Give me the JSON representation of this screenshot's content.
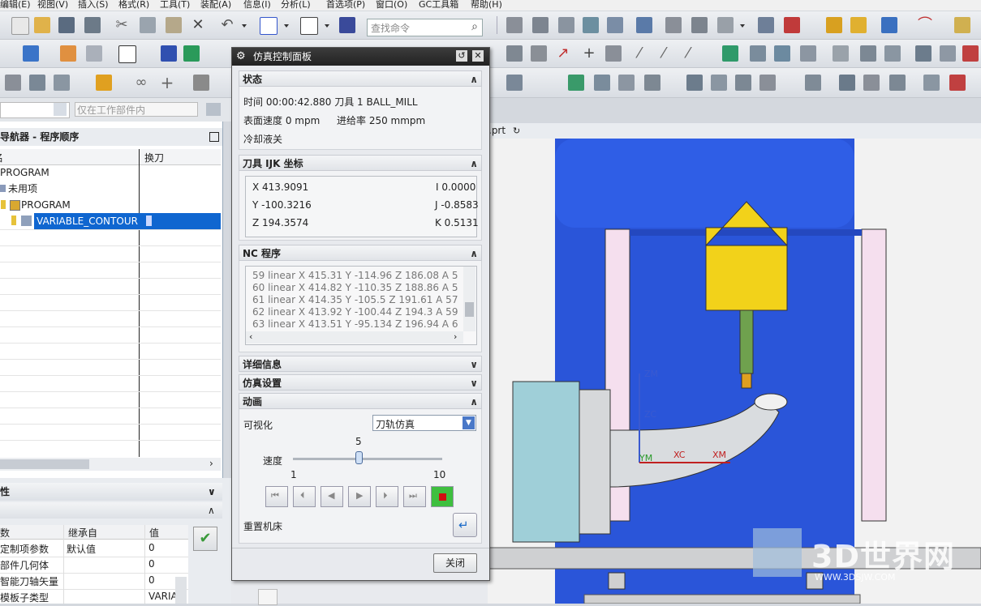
{
  "menubar": {
    "items": [
      "编辑(E)",
      "视图(V)",
      "插入(S)",
      "格式(R)",
      "工具(T)",
      "装配(A)",
      "信息(I)",
      "分析(L)",
      "首选项(P)",
      "窗口(O)",
      "GC工具箱",
      "帮助(H)"
    ]
  },
  "toolbar": {
    "search_placeholder": "查找命令"
  },
  "filter": {
    "scope": "仅在工作部件内"
  },
  "navigator": {
    "title": "导航器 - 程序顺序",
    "col_name": "名",
    "col_tool_change": "换刀",
    "rows": [
      {
        "label": "PROGRAM"
      },
      {
        "label": "未用项"
      },
      {
        "label": "PROGRAM"
      },
      {
        "label": "VARIABLE_CONTOUR"
      }
    ]
  },
  "properties": {
    "section1": "性",
    "section2": "",
    "col_param": "数",
    "col_inherit": "继承自",
    "col_value": "值",
    "rows": [
      {
        "param": "定制项参数",
        "inherit": "默认值",
        "value": "0"
      },
      {
        "param": "部件几何体",
        "inherit": "",
        "value": "0"
      },
      {
        "param": "智能刀轴矢量",
        "inherit": "",
        "value": "0"
      },
      {
        "param": "模板子类型",
        "inherit": "",
        "value": "VARIA"
      }
    ]
  },
  "dialog": {
    "title": "仿真控制面板",
    "status": {
      "header": "状态",
      "time_line": "时间 00:00:42.880 刀具 1   BALL_MILL",
      "surface_speed": "表面速度 0 mpm",
      "feed_rate": "进给率 250 mmpm",
      "coolant": "冷却液关"
    },
    "ijk": {
      "header": "刀具 IJK 坐标",
      "x": "X 413.9091",
      "i": "I 0.0000",
      "y": "Y -100.3216",
      "j": "J -0.8583",
      "z": "Z 194.3574",
      "k": "K 0.5131"
    },
    "nc": {
      "header": "NC 程序",
      "lines": [
        "59 linear X 415.31 Y -114.96 Z 186.08 A 5",
        "60 linear X 414.82 Y -110.35 Z 188.86 A 5",
        "61 linear X 414.35 Y -105.5 Z 191.61 A 57",
        "62 linear X 413.92 Y -100.44 Z 194.3 A 59",
        "63 linear X 413.51 Y -95.134 Z 196.94 A 6"
      ]
    },
    "details_header": "详细信息",
    "sim_settings_header": "仿真设置",
    "animation": {
      "header": "动画",
      "visualize_label": "可视化",
      "visualize_value": "刀轨仿真",
      "speed_label": "速度",
      "speed_value": "5",
      "speed_min": "1",
      "speed_max": "10",
      "speed_fraction": 0.44,
      "reset_label": "重置机床"
    },
    "close_label": "关闭"
  },
  "viewport": {
    "filename": ".prt",
    "axes": {
      "zm": "ZM",
      "zc": "ZC",
      "xc": "XC",
      "xm": "XM",
      "ym": "YM"
    },
    "colors": {
      "machine_blue": "#2a55d9",
      "spindle_yellow": "#f2d21a",
      "holder_green": "#6fa14e",
      "housing_cyan": "#9fcfd8"
    }
  },
  "watermark": {
    "text": "3D世界网",
    "url": "WWW.3DSJW.COM"
  }
}
